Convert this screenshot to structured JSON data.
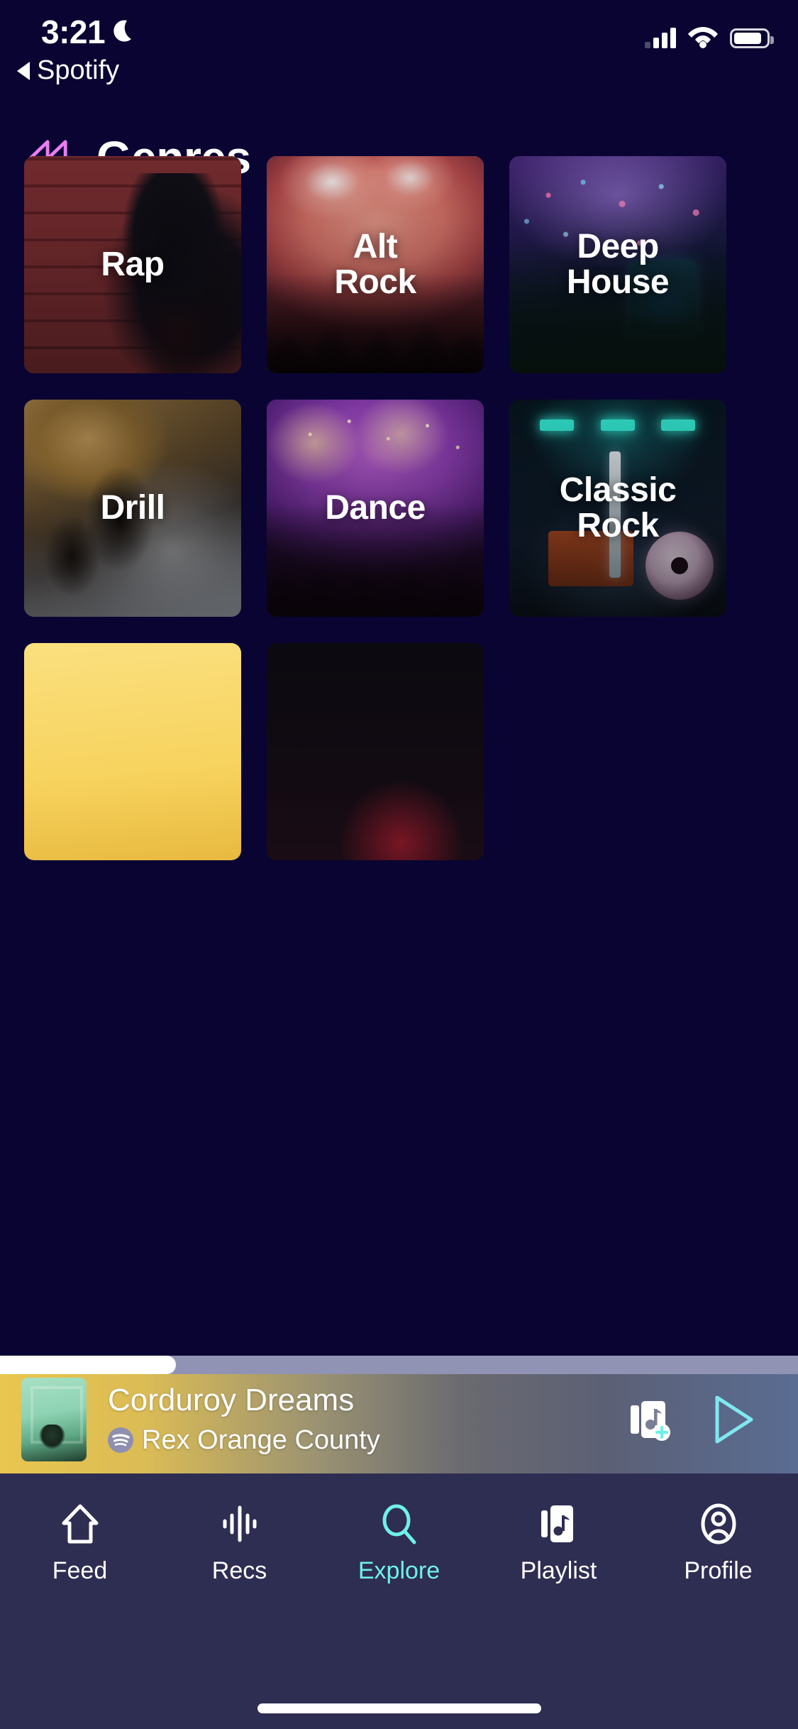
{
  "status_bar": {
    "time": "3:21",
    "dnd_icon": "moon-icon",
    "back_label": "Spotify",
    "signal_icon": "cellular-signal-icon",
    "wifi_icon": "wifi-icon",
    "battery_icon": "battery-icon"
  },
  "header": {
    "back_icon": "rewind-icon",
    "title": "Genres",
    "accent": "#e87ef0"
  },
  "grid": {
    "cards": [
      {
        "label": "Rap",
        "art": "art-rap",
        "name": "genre-card-rap"
      },
      {
        "label": "Alt\nRock",
        "art": "art-alt",
        "name": "genre-card-alt-rock"
      },
      {
        "label": "Deep\nHouse",
        "art": "art-deep",
        "name": "genre-card-deep-house"
      },
      {
        "label": "Drill",
        "art": "art-drill",
        "name": "genre-card-drill"
      },
      {
        "label": "Dance",
        "art": "art-dance",
        "name": "genre-card-dance"
      },
      {
        "label": "Classic\nRock",
        "art": "art-classic",
        "name": "genre-card-classic-rock"
      },
      {
        "label": "",
        "art": "art-yellow",
        "name": "genre-card-partial-left"
      },
      {
        "label": "",
        "art": "art-darkred",
        "name": "genre-card-partial-right"
      }
    ]
  },
  "mini_player": {
    "track_title": "Corduroy Dreams",
    "artist": "Rex Orange County",
    "source_icon": "spotify-icon",
    "add_to_playlist_icon": "add-to-playlist-icon",
    "play_icon": "play-icon",
    "progress_percent": 22,
    "accent": "#6ff0ea"
  },
  "tab_bar": {
    "active": "Explore",
    "active_color": "#6ff0ea",
    "items": [
      {
        "label": "Feed",
        "icon": "home-icon",
        "name": "tab-feed",
        "active": false
      },
      {
        "label": "Recs",
        "icon": "waveform-icon",
        "name": "tab-recs",
        "active": false
      },
      {
        "label": "Explore",
        "icon": "search-icon",
        "name": "tab-explore",
        "active": true
      },
      {
        "label": "Playlist",
        "icon": "playlist-icon",
        "name": "tab-playlist",
        "active": false
      },
      {
        "label": "Profile",
        "icon": "profile-icon",
        "name": "tab-profile",
        "active": false
      }
    ]
  },
  "colors": {
    "background": "#0a0433",
    "tab_bar_bg": "#2e2d52",
    "accent_pink": "#e87ef0",
    "accent_cyan": "#6ff0ea"
  }
}
